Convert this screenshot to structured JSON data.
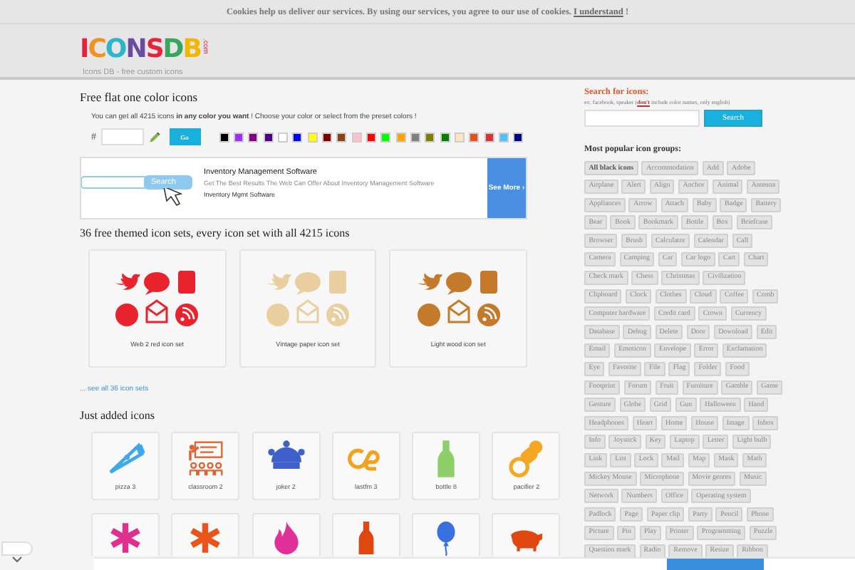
{
  "cookie_bar": {
    "text": "Cookies help us deliver our services. By using our services, you agree to our use of cookies.",
    "link": "I understand",
    "end": "!"
  },
  "header": {
    "logo": "ICONSDB",
    "logo_suffix": ".com",
    "tagline": "Icons DB - free custom icons"
  },
  "color_section": {
    "title": "Free flat one color icons",
    "intro": "You can get all 4215 icons **in any color you want** ! Choose your color or select from the preset colors !",
    "hash": "#",
    "go": "Go",
    "swatches": [
      {
        "color": "#000000"
      },
      {
        "color": "#9b30ff"
      },
      {
        "color": "#800080"
      },
      {
        "color": "#4b0082"
      },
      {
        "color": "#ffffff"
      },
      {
        "color": "#0000ff"
      },
      {
        "color": "#ffff00"
      },
      {
        "color": "#800000"
      },
      {
        "color": "#8b4513"
      },
      {
        "color": "#ffc0cb"
      },
      {
        "color": "#ff0000"
      },
      {
        "color": "#00ff00"
      },
      {
        "color": "#ffa500"
      },
      {
        "color": "#808080"
      },
      {
        "color": "#808000"
      },
      {
        "color": "#008000"
      },
      {
        "color": "#ffe4c4"
      },
      {
        "color": "#e2531f"
      },
      {
        "color": "#d03838"
      },
      {
        "color": "#4fc1f5"
      },
      {
        "color": "#000080"
      }
    ]
  },
  "ad": {
    "search_button": "Search",
    "title": "Inventory Management Software",
    "description": "Get The Best Results The Web Can Offer About Inventory Management Software",
    "source": "Inventory Mgmt Software",
    "button": "See More ›"
  },
  "sets_title": "36 free themed icon sets, every icon set with all 4215 icons",
  "icon_sets": [
    {
      "label": "Web 2 red icon set",
      "color": "#e8232e"
    },
    {
      "label": "Vintage paper icon set",
      "color": "#e9cf9f"
    },
    {
      "label": "Light wood icon set",
      "color": "#c47a2a"
    }
  ],
  "see_all": "... see all 36 icon sets",
  "just_added_title": "Just added icons",
  "just_added": [
    {
      "label": "pizza 3",
      "kind": "pizza",
      "color": "#3fa9e8"
    },
    {
      "label": "classroom 2",
      "kind": "classroom",
      "color": "#e0622e"
    },
    {
      "label": "joker 2",
      "kind": "joker",
      "color": "#3f5fc9"
    },
    {
      "label": "lastfm 3",
      "kind": "loop",
      "color": "#f4a21d"
    },
    {
      "label": "bottle 8",
      "kind": "bottle",
      "color": "#8fcf6a"
    },
    {
      "label": "pacifier 2",
      "kind": "pacifier",
      "color": "#f5a623"
    }
  ],
  "more_icons": [
    {
      "kind": "asterisk",
      "color": "#e0308f"
    },
    {
      "kind": "asterisk",
      "color": "#e8541c"
    },
    {
      "kind": "flame",
      "color": "#e0309a"
    },
    {
      "kind": "bottle",
      "color": "#e0460f"
    },
    {
      "kind": "balloon",
      "color": "#3a6fe0"
    },
    {
      "kind": "pig",
      "color": "#e0460f"
    }
  ],
  "search": {
    "title": "Search for icons:",
    "hint": "ex: facebook, speaker (**don't** include color names, only english)",
    "button": "Search"
  },
  "popular": {
    "title": "Most popular icon groups:",
    "tags": [
      {
        "label": "All black icons",
        "selected": true
      },
      {
        "label": "Accommodation",
        "selected": false
      },
      {
        "label": "Add",
        "selected": false
      },
      {
        "label": "Adobe",
        "selected": false
      },
      {
        "label": "Airplane",
        "selected": false
      },
      {
        "label": "Alert",
        "selected": false
      },
      {
        "label": "Align",
        "selected": false
      },
      {
        "label": "Anchor",
        "selected": false
      },
      {
        "label": "Animal",
        "selected": false
      },
      {
        "label": "Antenna",
        "selected": false
      },
      {
        "label": "Appliances",
        "selected": false
      },
      {
        "label": "Arrow",
        "selected": false
      },
      {
        "label": "Attach",
        "selected": false
      },
      {
        "label": "Baby",
        "selected": false
      },
      {
        "label": "Badge",
        "selected": false
      },
      {
        "label": "Battery",
        "selected": false
      },
      {
        "label": "Bear",
        "selected": false
      },
      {
        "label": "Book",
        "selected": false
      },
      {
        "label": "Bookmark",
        "selected": false
      },
      {
        "label": "Bottle",
        "selected": false
      },
      {
        "label": "Box",
        "selected": false
      },
      {
        "label": "Briefcase",
        "selected": false
      },
      {
        "label": "Browser",
        "selected": false
      },
      {
        "label": "Brush",
        "selected": false
      },
      {
        "label": "Calculator",
        "selected": false
      },
      {
        "label": "Calendar",
        "selected": false
      },
      {
        "label": "Call",
        "selected": false
      },
      {
        "label": "Camera",
        "selected": false
      },
      {
        "label": "Camping",
        "selected": false
      },
      {
        "label": "Car",
        "selected": false
      },
      {
        "label": "Car logo",
        "selected": false
      },
      {
        "label": "Cart",
        "selected": false
      },
      {
        "label": "Chart",
        "selected": false
      },
      {
        "label": "Check mark",
        "selected": false
      },
      {
        "label": "Chess",
        "selected": false
      },
      {
        "label": "Christmas",
        "selected": false
      },
      {
        "label": "Civilization",
        "selected": false
      },
      {
        "label": "Clipboard",
        "selected": false
      },
      {
        "label": "Clock",
        "selected": false
      },
      {
        "label": "Clothes",
        "selected": false
      },
      {
        "label": "Cloud",
        "selected": false
      },
      {
        "label": "Coffee",
        "selected": false
      },
      {
        "label": "Comb",
        "selected": false
      },
      {
        "label": "Computer hardware",
        "selected": false
      },
      {
        "label": "Credit card",
        "selected": false
      },
      {
        "label": "Crown",
        "selected": false
      },
      {
        "label": "Currency",
        "selected": false
      },
      {
        "label": "Database",
        "selected": false
      },
      {
        "label": "Debug",
        "selected": false
      },
      {
        "label": "Delete",
        "selected": false
      },
      {
        "label": "Door",
        "selected": false
      },
      {
        "label": "Download",
        "selected": false
      },
      {
        "label": "Edit",
        "selected": false
      },
      {
        "label": "Email",
        "selected": false
      },
      {
        "label": "Emoticon",
        "selected": false
      },
      {
        "label": "Envelope",
        "selected": false
      },
      {
        "label": "Error",
        "selected": false
      },
      {
        "label": "Exclamation",
        "selected": false
      },
      {
        "label": "Eye",
        "selected": false
      },
      {
        "label": "Favorite",
        "selected": false
      },
      {
        "label": "File",
        "selected": false
      },
      {
        "label": "Flag",
        "selected": false
      },
      {
        "label": "Folder",
        "selected": false
      },
      {
        "label": "Food",
        "selected": false
      },
      {
        "label": "Footprint",
        "selected": false
      },
      {
        "label": "Forum",
        "selected": false
      },
      {
        "label": "Fruit",
        "selected": false
      },
      {
        "label": "Furniture",
        "selected": false
      },
      {
        "label": "Gamble",
        "selected": false
      },
      {
        "label": "Game",
        "selected": false
      },
      {
        "label": "Gesture",
        "selected": false
      },
      {
        "label": "Globe",
        "selected": false
      },
      {
        "label": "Grid",
        "selected": false
      },
      {
        "label": "Gun",
        "selected": false
      },
      {
        "label": "Halloween",
        "selected": false
      },
      {
        "label": "Hand",
        "selected": false
      },
      {
        "label": "Headphones",
        "selected": false
      },
      {
        "label": "Heart",
        "selected": false
      },
      {
        "label": "Home",
        "selected": false
      },
      {
        "label": "House",
        "selected": false
      },
      {
        "label": "Image",
        "selected": false
      },
      {
        "label": "Inbox",
        "selected": false
      },
      {
        "label": "Info",
        "selected": false
      },
      {
        "label": "Joystick",
        "selected": false
      },
      {
        "label": "Key",
        "selected": false
      },
      {
        "label": "Laptop",
        "selected": false
      },
      {
        "label": "Letter",
        "selected": false
      },
      {
        "label": "Light bulb",
        "selected": false
      },
      {
        "label": "Link",
        "selected": false
      },
      {
        "label": "List",
        "selected": false
      },
      {
        "label": "Lock",
        "selected": false
      },
      {
        "label": "Mail",
        "selected": false
      },
      {
        "label": "Map",
        "selected": false
      },
      {
        "label": "Mask",
        "selected": false
      },
      {
        "label": "Math",
        "selected": false
      },
      {
        "label": "Mickey Mouse",
        "selected": false
      },
      {
        "label": "Microphone",
        "selected": false
      },
      {
        "label": "Movie genres",
        "selected": false
      },
      {
        "label": "Music",
        "selected": false
      },
      {
        "label": "Network",
        "selected": false
      },
      {
        "label": "Numbers",
        "selected": false
      },
      {
        "label": "Office",
        "selected": false
      },
      {
        "label": "Operating system",
        "selected": false
      },
      {
        "label": "Padlock",
        "selected": false
      },
      {
        "label": "Page",
        "selected": false
      },
      {
        "label": "Paper clip",
        "selected": false
      },
      {
        "label": "Party",
        "selected": false
      },
      {
        "label": "Pencil",
        "selected": false
      },
      {
        "label": "Phone",
        "selected": false
      },
      {
        "label": "Picture",
        "selected": false
      },
      {
        "label": "Pin",
        "selected": false
      },
      {
        "label": "Play",
        "selected": false
      },
      {
        "label": "Printer",
        "selected": false
      },
      {
        "label": "Programming",
        "selected": false
      },
      {
        "label": "Puzzle",
        "selected": false
      },
      {
        "label": "Question mark",
        "selected": false
      },
      {
        "label": "Radio",
        "selected": false
      },
      {
        "label": "Remove",
        "selected": false
      },
      {
        "label": "Resize",
        "selected": false
      },
      {
        "label": "Ribbon",
        "selected": false
      }
    ]
  }
}
